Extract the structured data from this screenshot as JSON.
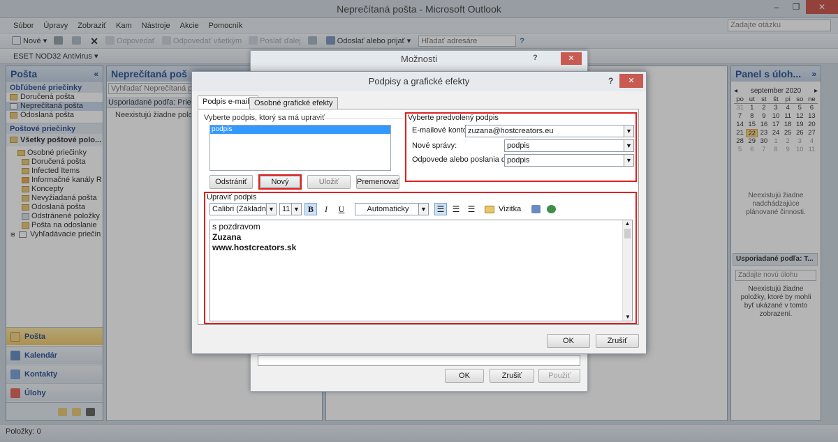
{
  "window": {
    "title": "Neprečítaná pošta - Microsoft Outlook",
    "minimize": "–",
    "maximize": "❐",
    "close": "✕"
  },
  "menu": {
    "items": [
      "Súbor",
      "Úpravy",
      "Zobraziť",
      "Kam",
      "Nástroje",
      "Akcie",
      "Pomocník"
    ],
    "help_placeholder": "Zadajte otázku"
  },
  "toolbar": {
    "new": "Nové",
    "reply": "Odpovedať",
    "reply_all": "Odpovedať všetkým",
    "forward": "Poslať ďalej",
    "send_receive": "Odoslať alebo prijať",
    "address_search": "Hľadať adresáre"
  },
  "toolbar2": {
    "antivirus": "ESET NOD32 Antivirus"
  },
  "nav": {
    "title": "Pošta",
    "favorites_header": "Obľúbené priečinky",
    "favorites": [
      "Doručená pošta",
      "Neprečítaná pošta",
      "Odoslaná pošta"
    ],
    "mail_header": "Poštové priečinky",
    "all_items": "Všetky poštové polo...",
    "root": "Osobné priečinky",
    "folders": [
      "Doručená pošta",
      "Infected Items",
      "Informačné kanály R",
      "Koncepty",
      "Nevyžiadaná pošta",
      "Odoslaná pošta",
      "Odstránené položky",
      "Pošta na odoslanie"
    ],
    "search_folders": "Vyhľadávacie priečin",
    "buttons": [
      "Pošta",
      "Kalendár",
      "Kontakty",
      "Úlohy"
    ]
  },
  "list": {
    "title": "Neprečítaná poš",
    "search_placeholder": "Vyhľadať Neprečítaná pošta",
    "arrange": "Usporiadané podľa: Priečinc",
    "empty": "Neexistujú žiadne položky"
  },
  "tasks": {
    "title": "Panel s úloh...",
    "month": "september 2020",
    "weekdays": [
      "po",
      "ut",
      "st",
      "št",
      "pi",
      "so",
      "ne"
    ],
    "weeks": [
      [
        "31",
        "1",
        "2",
        "3",
        "4",
        "5",
        "6"
      ],
      [
        "7",
        "8",
        "9",
        "10",
        "11",
        "12",
        "13"
      ],
      [
        "14",
        "15",
        "16",
        "17",
        "18",
        "19",
        "20"
      ],
      [
        "21",
        "22",
        "23",
        "24",
        "25",
        "26",
        "27"
      ],
      [
        "28",
        "29",
        "30",
        "1",
        "2",
        "3",
        "4"
      ],
      [
        "5",
        "6",
        "7",
        "8",
        "9",
        "10",
        "11"
      ]
    ],
    "today": "22",
    "no_appointments": "Neexistujú žiadne nadchádzajúce plánované činnosti.",
    "arrange": "Usporiadané podľa: T...",
    "new_task_placeholder": "Zadajte novú úlohu",
    "no_tasks": "Neexistujú žiadne položky, ktoré by mohli byť ukázané v tomto zobrazení."
  },
  "status": {
    "items": "Položky: 0"
  },
  "options_dialog": {
    "title": "Možnosti",
    "ok": "OK",
    "cancel": "Zrušiť",
    "apply": "Použiť"
  },
  "sig_dialog": {
    "title": "Podpisy a grafické efekty",
    "help": "?",
    "close": "✕",
    "tabs": [
      "Podpis e-mailu",
      "Osobné grafické efekty"
    ],
    "select_label": "Vyberte podpis, ktorý sa má upraviť",
    "signatures": [
      "podpis"
    ],
    "btn_delete": "Odstrániť",
    "btn_new": "Nový",
    "btn_save": "Uložiť",
    "btn_rename": "Premenovať",
    "default_group": "Vyberte predvolený podpis",
    "account_label": "E-mailové konto:",
    "account_value": "zuzana@hostcreators.eu",
    "new_msg_label": "Nové správy:",
    "new_msg_value": "podpis",
    "reply_label": "Odpovede alebo poslania ďalej:",
    "reply_value": "podpis",
    "edit_label": "Upraviť podpis",
    "font": "Calibri (Základný te:",
    "size": "11",
    "bold": "B",
    "italic": "I",
    "underline": "U",
    "color": "Automaticky",
    "vcard": "Vizitka",
    "body_lines": [
      "s pozdravom",
      "Zuzana",
      "www.hostcreators.sk"
    ],
    "ok": "OK",
    "cancel": "Zrušiť"
  },
  "colors": {
    "highlight": "#e02020",
    "accent": "#15428b",
    "active_nav": "#f2c55c"
  }
}
